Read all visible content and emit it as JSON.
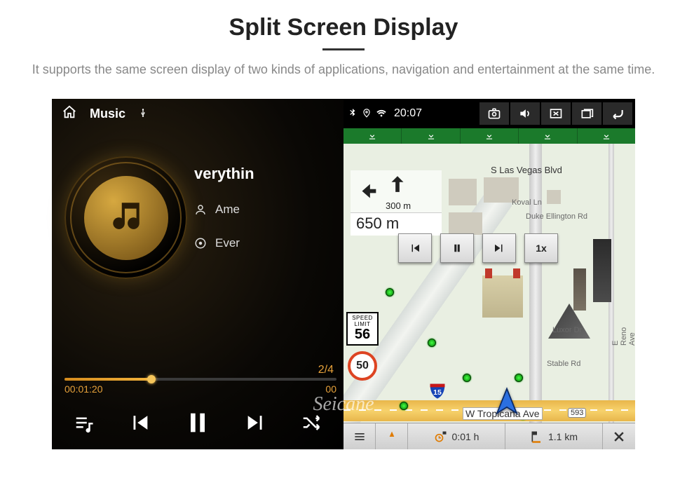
{
  "header": {
    "title": "Split Screen Display",
    "subtitle": "It supports the same screen display of two kinds of applications, navigation and entertainment at the same time."
  },
  "status_left": {
    "app_label": "Music",
    "source": "USB"
  },
  "status_right": {
    "clock": "20:07"
  },
  "music": {
    "title_partial": "verythin",
    "artist_partial": "Ame",
    "album_partial": "Ever",
    "track_counter": "2/4",
    "elapsed": "00:01:20",
    "total": "00"
  },
  "nav": {
    "download_count": 5,
    "turn": {
      "next_in": "300 m",
      "main_dist": "650 m"
    },
    "playback_speed": "1x",
    "speed_limit_label_top": "SPEED",
    "speed_limit_label_bottom": "LIMIT",
    "speed_limit_value": "56",
    "current_speed": "50",
    "interstate": "15",
    "streets": {
      "blvd": "S Las Vegas Blvd",
      "koval": "Koval Ln",
      "duke": "Duke Ellington Rd",
      "luxor": "Luxor Dr",
      "stable": "Stable Rd",
      "reno": "E Reno Ave",
      "tropicana": "W Tropicana Ave",
      "tropicana_code": "593"
    },
    "bottom": {
      "orientation": "N",
      "eta_remaining": "0:01 h",
      "dist_remaining": "1.1 km"
    }
  },
  "watermark": "Seicane"
}
